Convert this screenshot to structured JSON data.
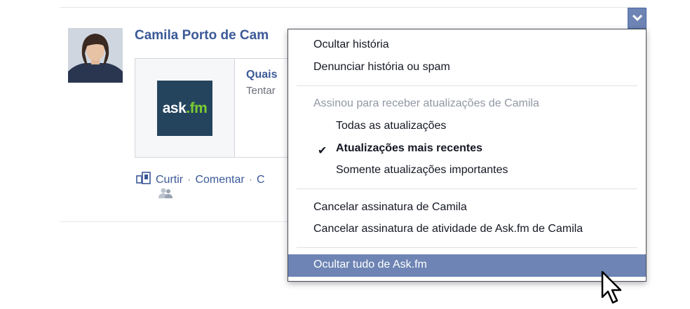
{
  "post": {
    "author_name": "Camila Porto de Cam",
    "card_title": "Quais",
    "card_subtitle": "Tentar",
    "card_logo_text": "ask",
    "card_logo_suffix": ".fm"
  },
  "actions": {
    "like": "Curtir",
    "comment": "Comentar",
    "more": "C",
    "separator": "·"
  },
  "menu": {
    "hide_story": "Ocultar história",
    "report_story": "Denunciar história ou spam",
    "subscribed_header": "Assinou para receber atualizações de Camila",
    "all_updates": "Todas as atualizações",
    "most_recent_updates": "Atualizações mais recentes",
    "important_updates": "Somente atualizações importantes",
    "unsubscribe": "Cancelar assinatura de Camila",
    "unsubscribe_activity": "Cancelar assinatura de atividade de Ask.fm de Camila",
    "hide_all": "Ocultar tudo de Ask.fm",
    "checked_item": "most_recent_updates",
    "check_mark": "✔"
  },
  "colors": {
    "link_blue": "#3b5998",
    "menu_highlight": "#6d84b4",
    "askfm_bg": "#24445e",
    "askfm_green": "#7ccc31"
  },
  "icons": [
    "chevron-down-icon",
    "like-icon",
    "friends-icon",
    "check-icon",
    "mouse-pointer-icon"
  ]
}
